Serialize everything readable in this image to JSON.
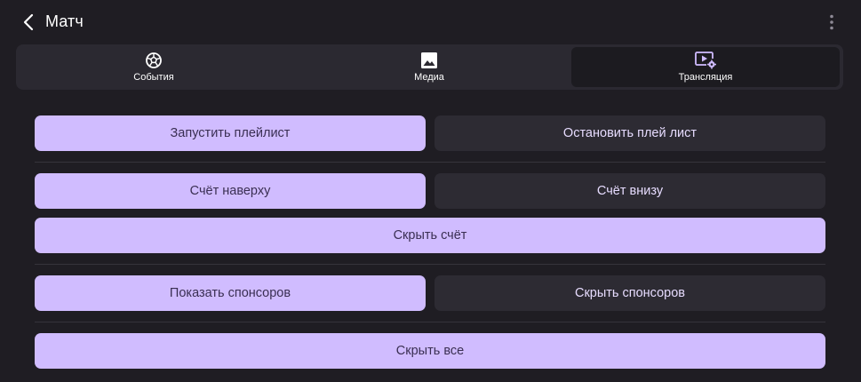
{
  "header": {
    "title": "Матч",
    "back_icon": "chevron-left-icon",
    "more_icon": "more-vertical-icon"
  },
  "tabs": [
    {
      "label": "События",
      "icon": "soccer-ball-icon",
      "active": false
    },
    {
      "label": "Медиа",
      "icon": "image-icon",
      "active": false
    },
    {
      "label": "Трансляция",
      "icon": "video-settings-icon",
      "active": true
    }
  ],
  "controls": {
    "start_playlist": "Запустить плейлист",
    "stop_playlist": "Остановить плей лист",
    "score_top": "Счёт наверху",
    "score_bottom": "Счёт внизу",
    "hide_score": "Скрыть счёт",
    "show_sponsors": "Показать спонсоров",
    "hide_sponsors": "Скрыть спонсоров",
    "hide_all": "Скрыть все"
  },
  "colors": {
    "background": "#1f1d23",
    "primary_button": "#d0bcff",
    "secondary_button": "#2d2b33",
    "accent": "#d0bcff"
  }
}
